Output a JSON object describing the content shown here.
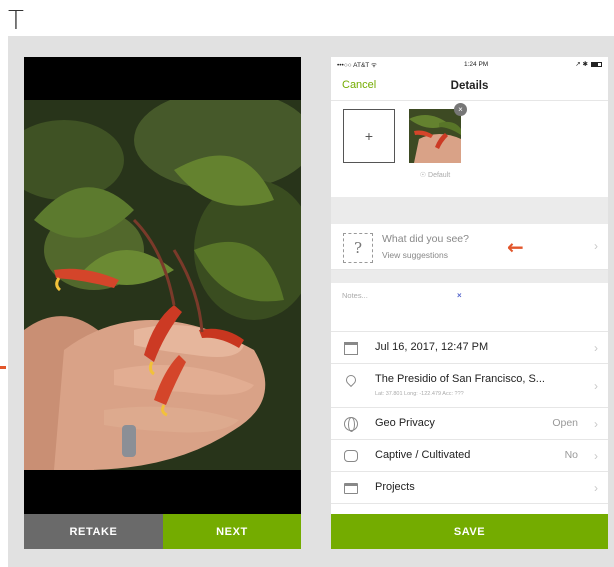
{
  "page": {
    "top_letter": "T"
  },
  "camera": {
    "retake_label": "RETAKE",
    "next_label": "NEXT"
  },
  "phone": {
    "status": {
      "carrier": "•••○○ AT&T ᯤ",
      "time": "1:24 PM",
      "right": "↗ ✱"
    },
    "nav": {
      "cancel_label": "Cancel",
      "title": "Details"
    },
    "photos": {
      "add_symbol": "+",
      "close_symbol": "×",
      "default_label": "☉ Default"
    },
    "species": {
      "question": "What did you see?",
      "suggestions": "View suggestions",
      "icon_glyph": "?"
    },
    "notes": {
      "placeholder": "Notes...",
      "clear_symbol": "×"
    },
    "date_row": {
      "label": "Jul 16, 2017, 12:47 PM"
    },
    "location_row": {
      "label": "The Presidio of San Francisco, S...",
      "coords": "Lat: 37.801  Long: -122.479  Acc: ???"
    },
    "geo_privacy_row": {
      "label": "Geo Privacy",
      "value": "Open"
    },
    "captive_row": {
      "label": "Captive / Cultivated",
      "value": "No"
    },
    "projects_row": {
      "label": "Projects"
    },
    "save_label": "SAVE",
    "chevron": "›"
  },
  "colors": {
    "brand_green": "#74ac00",
    "arrow_orange": "#e2562b",
    "retake_grey": "#6a6a6a"
  },
  "icons": [
    "plus-icon",
    "close-icon",
    "question-box-icon",
    "arrow-left-icon",
    "calendar-icon",
    "location-pin-icon",
    "globe-icon",
    "fence-icon",
    "projects-icon",
    "chevron-right-icon"
  ]
}
